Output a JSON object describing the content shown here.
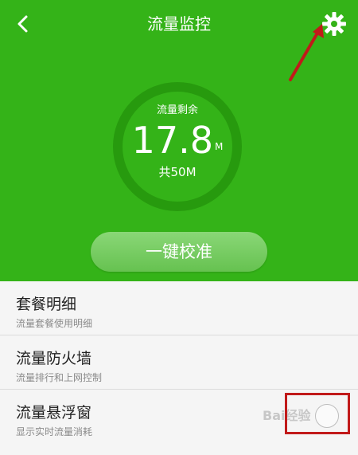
{
  "header": {
    "title": "流量监控",
    "back_icon": "chevron-left-icon",
    "settings_icon": "gear-icon"
  },
  "usage": {
    "remaining_label": "流量剩余",
    "remaining_value": "17.8",
    "remaining_unit": "M",
    "total_label": "共50M"
  },
  "calibrate_button": "一键校准",
  "list": [
    {
      "title": "套餐明细",
      "subtitle": "流量套餐使用明细"
    },
    {
      "title": "流量防火墙",
      "subtitle": "流量排行和上网控制"
    },
    {
      "title": "流量悬浮窗",
      "subtitle": "显示实时流量消耗"
    }
  ],
  "floating_window_toggle": {
    "state": "off"
  },
  "watermark": "Bai经验",
  "colors": {
    "header_green": "#34b318",
    "ring_dark_green": "#279a0e",
    "annotation_red": "#c11a1a"
  }
}
